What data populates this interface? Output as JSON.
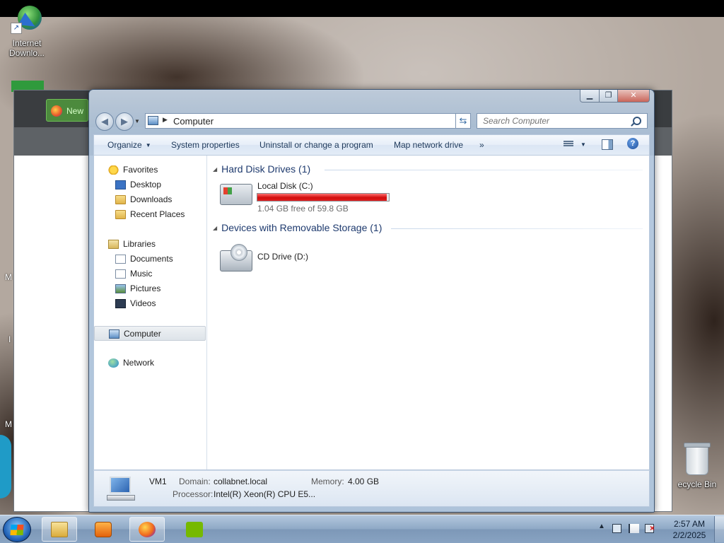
{
  "desktop": {
    "icons": [
      {
        "label_line1": "Internet",
        "label_line2": "Downlo..."
      },
      {
        "label": "ecycle Bin"
      }
    ],
    "edge_letters": [
      "M",
      "I",
      "M"
    ]
  },
  "background_window": {
    "new_button_label": "New"
  },
  "explorer": {
    "address": {
      "crumb": "Computer"
    },
    "search": {
      "placeholder": "Search Computer"
    },
    "toolbar": {
      "organize_label": "Organize",
      "system_properties_label": "System properties",
      "uninstall_label": "Uninstall or change a program",
      "map_drive_label": "Map network drive",
      "more_label": "»"
    },
    "nav": {
      "favorites": "Favorites",
      "desktop": "Desktop",
      "downloads": "Downloads",
      "recent_places": "Recent Places",
      "libraries": "Libraries",
      "documents": "Documents",
      "music": "Music",
      "pictures": "Pictures",
      "videos": "Videos",
      "computer": "Computer",
      "network": "Network"
    },
    "groups": {
      "hard_disk": {
        "title": "Hard Disk Drives (1)",
        "drives": [
          {
            "name": "Local Disk (C:)",
            "free_text": "1.04 GB free of 59.8 GB",
            "used_fraction": 0.983,
            "bar_color": "#d10c0c"
          }
        ]
      },
      "removable": {
        "title": "Devices with Removable Storage (1)",
        "drives": [
          {
            "name": "CD Drive (D:)"
          }
        ]
      }
    },
    "details": {
      "computer_name": "VM1",
      "domain_label": "Domain:",
      "domain_value": "collabnet.local",
      "memory_label": "Memory:",
      "memory_value": "4.00 GB",
      "processor_label": "Processor:",
      "processor_value": "Intel(R) Xeon(R) CPU E5..."
    }
  },
  "taskbar": {
    "pinned": [
      "start-button",
      "windows-explorer",
      "media-player",
      "firefox",
      "nvidia"
    ],
    "tray_chevron": "▲",
    "clock": {
      "time": "2:57 AM",
      "date": "2/2/2025"
    }
  }
}
